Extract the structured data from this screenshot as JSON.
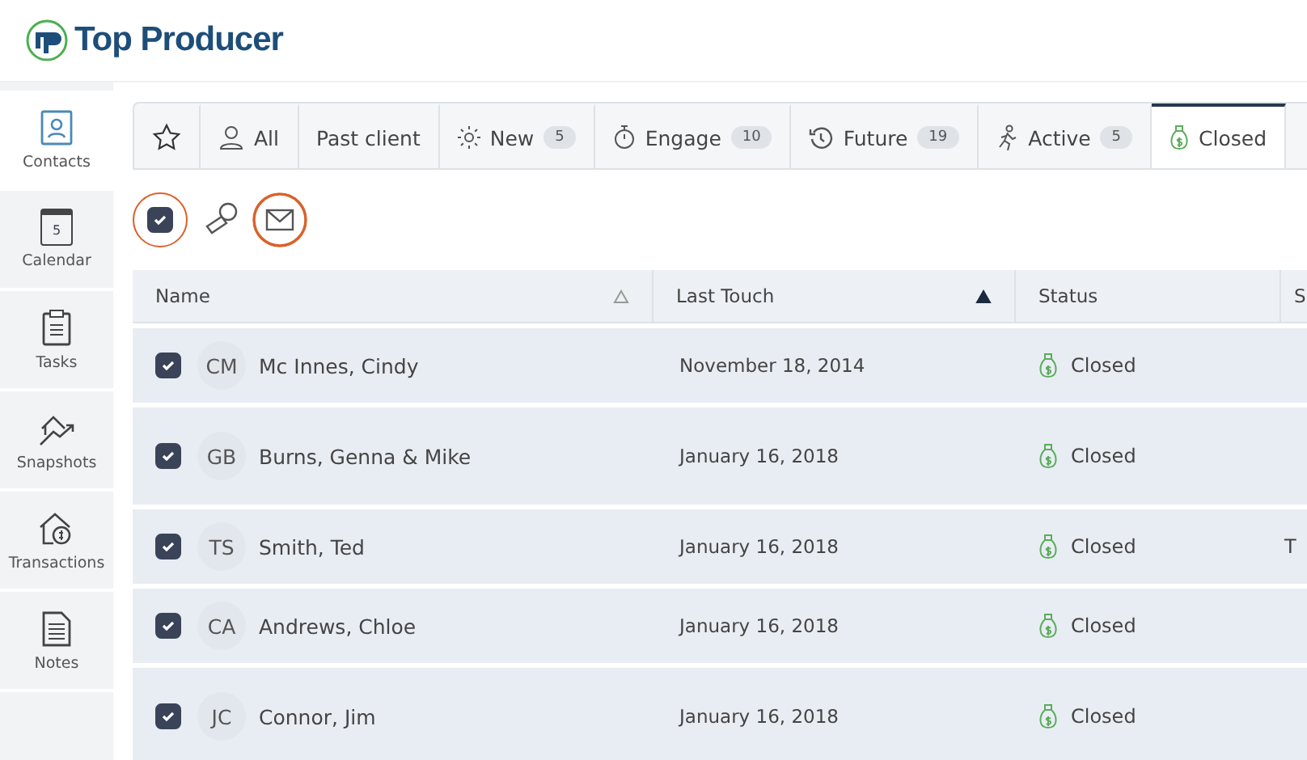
{
  "logo": {
    "name": "Top Producer"
  },
  "sidebar": {
    "items": [
      {
        "label": "Contacts",
        "selected": true
      },
      {
        "label": "Calendar",
        "selected": false,
        "icon_text": "5"
      },
      {
        "label": "Tasks",
        "selected": false
      },
      {
        "label": "Snapshots",
        "selected": false
      },
      {
        "label": "Transactions",
        "selected": false
      },
      {
        "label": "Notes",
        "selected": false
      }
    ]
  },
  "tabs": [
    {
      "kind": "icon",
      "selected": false
    },
    {
      "kind": "label",
      "label": "All",
      "selected": false
    },
    {
      "kind": "label",
      "label": "Past client",
      "selected": false
    },
    {
      "kind": "label",
      "label": "New",
      "count": "5",
      "selected": false
    },
    {
      "kind": "label",
      "label": "Engage",
      "count": "10",
      "selected": false
    },
    {
      "kind": "label",
      "label": "Future",
      "count": "19",
      "selected": false
    },
    {
      "kind": "label",
      "label": "Active",
      "count": "5",
      "selected": false
    },
    {
      "kind": "label",
      "label": "Closed",
      "selected": true
    }
  ],
  "toolbar": {
    "select_all_checked": true
  },
  "table": {
    "columns": [
      {
        "label": "Name",
        "sorted": false
      },
      {
        "label": "Last Touch",
        "sorted": true
      },
      {
        "label": "Status"
      },
      {
        "label": "S"
      }
    ],
    "rows": [
      {
        "checked": true,
        "initials": "CM",
        "name": "Mc Innes, Cindy",
        "last_touch": "November 18, 2014",
        "status": "Closed",
        "tall": false
      },
      {
        "checked": true,
        "initials": "GB",
        "name": "Burns, Genna & Mike",
        "last_touch": "January 16, 2018",
        "status": "Closed",
        "tall": true
      },
      {
        "checked": true,
        "initials": "TS",
        "name": "Smith, Ted",
        "last_touch": "January 16, 2018",
        "status": "Closed",
        "tall": false,
        "column_4": "T"
      },
      {
        "checked": true,
        "initials": "CA",
        "name": "Andrews, Chloe",
        "last_touch": "January 16, 2018",
        "status": "Closed",
        "tall": false
      },
      {
        "checked": true,
        "initials": "JC",
        "name": "Connor, Jim",
        "last_touch": "January 16, 2018",
        "status": "Closed",
        "tall": true
      }
    ]
  }
}
